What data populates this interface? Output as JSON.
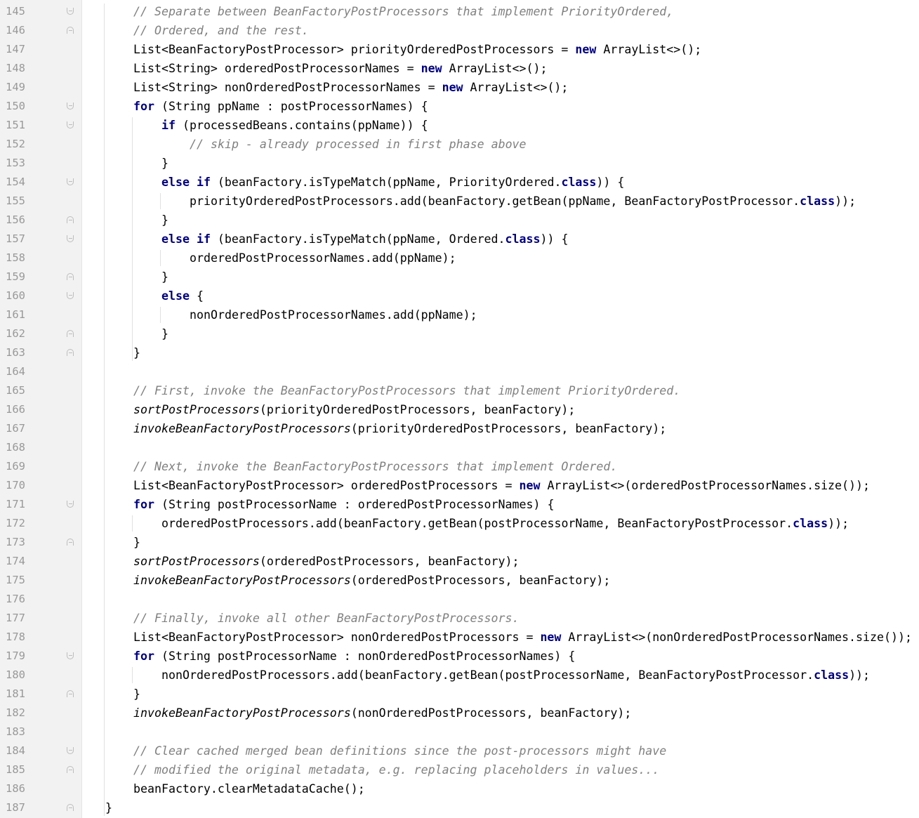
{
  "editor": {
    "colors": {
      "comment": "#808080",
      "keyword": "#000080",
      "line_number": "#999999",
      "gutter_bg": "#f2f2f2"
    },
    "lines": [
      {
        "num": "145",
        "fold": "open",
        "indent": 2,
        "code": [
          {
            "t": "// Separate between BeanFactoryPostProcessors that implement PriorityOrdered,",
            "c": "cmt"
          }
        ]
      },
      {
        "num": "146",
        "fold": "close",
        "indent": 2,
        "code": [
          {
            "t": "// Ordered, and the rest.",
            "c": "cmt"
          }
        ]
      },
      {
        "num": "147",
        "fold": "",
        "indent": 2,
        "code": [
          {
            "t": "List<BeanFactoryPostProcessor> priorityOrderedPostProcessors = ",
            "c": ""
          },
          {
            "t": "new",
            "c": "kw"
          },
          {
            "t": " ArrayList<>();",
            "c": ""
          }
        ]
      },
      {
        "num": "148",
        "fold": "",
        "indent": 2,
        "code": [
          {
            "t": "List<String> orderedPostProcessorNames = ",
            "c": ""
          },
          {
            "t": "new",
            "c": "kw"
          },
          {
            "t": " ArrayList<>();",
            "c": ""
          }
        ]
      },
      {
        "num": "149",
        "fold": "",
        "indent": 2,
        "code": [
          {
            "t": "List<String> nonOrderedPostProcessorNames = ",
            "c": ""
          },
          {
            "t": "new",
            "c": "kw"
          },
          {
            "t": " ArrayList<>();",
            "c": ""
          }
        ]
      },
      {
        "num": "150",
        "fold": "open",
        "indent": 2,
        "code": [
          {
            "t": "for",
            "c": "kw"
          },
          {
            "t": " (String ppName : postProcessorNames) {",
            "c": ""
          }
        ]
      },
      {
        "num": "151",
        "fold": "open",
        "indent": 3,
        "code": [
          {
            "t": "if",
            "c": "kw"
          },
          {
            "t": " (processedBeans.contains(ppName)) {",
            "c": ""
          }
        ]
      },
      {
        "num": "152",
        "fold": "",
        "indent": 4,
        "code": [
          {
            "t": "// skip - already processed in first phase above",
            "c": "cmt"
          }
        ]
      },
      {
        "num": "153",
        "fold": "",
        "indent": 3,
        "code": [
          {
            "t": "}",
            "c": ""
          }
        ]
      },
      {
        "num": "154",
        "fold": "open",
        "indent": 3,
        "code": [
          {
            "t": "else if",
            "c": "kw"
          },
          {
            "t": " (beanFactory.isTypeMatch(ppName, PriorityOrdered.",
            "c": ""
          },
          {
            "t": "class",
            "c": "kw"
          },
          {
            "t": ")) {",
            "c": ""
          }
        ]
      },
      {
        "num": "155",
        "fold": "",
        "indent": 4,
        "code": [
          {
            "t": "priorityOrderedPostProcessors.add(beanFactory.getBean(ppName, BeanFactoryPostProcessor.",
            "c": ""
          },
          {
            "t": "class",
            "c": "kw"
          },
          {
            "t": "));",
            "c": ""
          }
        ]
      },
      {
        "num": "156",
        "fold": "close",
        "indent": 3,
        "code": [
          {
            "t": "}",
            "c": ""
          }
        ]
      },
      {
        "num": "157",
        "fold": "open",
        "indent": 3,
        "code": [
          {
            "t": "else if",
            "c": "kw"
          },
          {
            "t": " (beanFactory.isTypeMatch(ppName, Ordered.",
            "c": ""
          },
          {
            "t": "class",
            "c": "kw"
          },
          {
            "t": ")) {",
            "c": ""
          }
        ]
      },
      {
        "num": "158",
        "fold": "",
        "indent": 4,
        "code": [
          {
            "t": "orderedPostProcessorNames.add(ppName);",
            "c": ""
          }
        ]
      },
      {
        "num": "159",
        "fold": "close",
        "indent": 3,
        "code": [
          {
            "t": "}",
            "c": ""
          }
        ]
      },
      {
        "num": "160",
        "fold": "open",
        "indent": 3,
        "code": [
          {
            "t": "else",
            "c": "kw"
          },
          {
            "t": " {",
            "c": ""
          }
        ]
      },
      {
        "num": "161",
        "fold": "",
        "indent": 4,
        "code": [
          {
            "t": "nonOrderedPostProcessorNames.add(ppName);",
            "c": ""
          }
        ]
      },
      {
        "num": "162",
        "fold": "close",
        "indent": 3,
        "code": [
          {
            "t": "}",
            "c": ""
          }
        ]
      },
      {
        "num": "163",
        "fold": "close",
        "indent": 2,
        "code": [
          {
            "t": "}",
            "c": ""
          }
        ]
      },
      {
        "num": "164",
        "fold": "",
        "indent": 2,
        "code": []
      },
      {
        "num": "165",
        "fold": "",
        "indent": 2,
        "code": [
          {
            "t": "// First, invoke the BeanFactoryPostProcessors that implement PriorityOrdered.",
            "c": "cmt"
          }
        ]
      },
      {
        "num": "166",
        "fold": "",
        "indent": 2,
        "code": [
          {
            "t": "sortPostProcessors",
            "c": "ital"
          },
          {
            "t": "(priorityOrderedPostProcessors, beanFactory);",
            "c": ""
          }
        ]
      },
      {
        "num": "167",
        "fold": "",
        "indent": 2,
        "code": [
          {
            "t": "invokeBeanFactoryPostProcessors",
            "c": "ital"
          },
          {
            "t": "(priorityOrderedPostProcessors, beanFactory);",
            "c": ""
          }
        ]
      },
      {
        "num": "168",
        "fold": "",
        "indent": 2,
        "code": []
      },
      {
        "num": "169",
        "fold": "",
        "indent": 2,
        "code": [
          {
            "t": "// Next, invoke the BeanFactoryPostProcessors that implement Ordered.",
            "c": "cmt"
          }
        ]
      },
      {
        "num": "170",
        "fold": "",
        "indent": 2,
        "code": [
          {
            "t": "List<BeanFactoryPostProcessor> orderedPostProcessors = ",
            "c": ""
          },
          {
            "t": "new",
            "c": "kw"
          },
          {
            "t": " ArrayList<>(orderedPostProcessorNames.size());",
            "c": ""
          }
        ]
      },
      {
        "num": "171",
        "fold": "open",
        "indent": 2,
        "code": [
          {
            "t": "for",
            "c": "kw"
          },
          {
            "t": " (String postProcessorName : orderedPostProcessorNames) {",
            "c": ""
          }
        ]
      },
      {
        "num": "172",
        "fold": "",
        "indent": 3,
        "code": [
          {
            "t": "orderedPostProcessors.add(beanFactory.getBean(postProcessorName, BeanFactoryPostProcessor.",
            "c": ""
          },
          {
            "t": "class",
            "c": "kw"
          },
          {
            "t": "));",
            "c": ""
          }
        ]
      },
      {
        "num": "173",
        "fold": "close",
        "indent": 2,
        "code": [
          {
            "t": "}",
            "c": ""
          }
        ]
      },
      {
        "num": "174",
        "fold": "",
        "indent": 2,
        "code": [
          {
            "t": "sortPostProcessors",
            "c": "ital"
          },
          {
            "t": "(orderedPostProcessors, beanFactory);",
            "c": ""
          }
        ]
      },
      {
        "num": "175",
        "fold": "",
        "indent": 2,
        "code": [
          {
            "t": "invokeBeanFactoryPostProcessors",
            "c": "ital"
          },
          {
            "t": "(orderedPostProcessors, beanFactory);",
            "c": ""
          }
        ]
      },
      {
        "num": "176",
        "fold": "",
        "indent": 2,
        "code": []
      },
      {
        "num": "177",
        "fold": "",
        "indent": 2,
        "code": [
          {
            "t": "// Finally, invoke all other BeanFactoryPostProcessors.",
            "c": "cmt"
          }
        ]
      },
      {
        "num": "178",
        "fold": "",
        "indent": 2,
        "code": [
          {
            "t": "List<BeanFactoryPostProcessor> nonOrderedPostProcessors = ",
            "c": ""
          },
          {
            "t": "new",
            "c": "kw"
          },
          {
            "t": " ArrayList<>(nonOrderedPostProcessorNames.size());",
            "c": ""
          }
        ]
      },
      {
        "num": "179",
        "fold": "open",
        "indent": 2,
        "code": [
          {
            "t": "for",
            "c": "kw"
          },
          {
            "t": " (String postProcessorName : nonOrderedPostProcessorNames) {",
            "c": ""
          }
        ]
      },
      {
        "num": "180",
        "fold": "",
        "indent": 3,
        "code": [
          {
            "t": "nonOrderedPostProcessors.add(beanFactory.getBean(postProcessorName, BeanFactoryPostProcessor.",
            "c": ""
          },
          {
            "t": "class",
            "c": "kw"
          },
          {
            "t": "));",
            "c": ""
          }
        ]
      },
      {
        "num": "181",
        "fold": "close",
        "indent": 2,
        "code": [
          {
            "t": "}",
            "c": ""
          }
        ]
      },
      {
        "num": "182",
        "fold": "",
        "indent": 2,
        "code": [
          {
            "t": "invokeBeanFactoryPostProcessors",
            "c": "ital"
          },
          {
            "t": "(nonOrderedPostProcessors, beanFactory);",
            "c": ""
          }
        ]
      },
      {
        "num": "183",
        "fold": "",
        "indent": 2,
        "code": []
      },
      {
        "num": "184",
        "fold": "open",
        "indent": 2,
        "code": [
          {
            "t": "// Clear cached merged bean definitions since the post-processors might have",
            "c": "cmt"
          }
        ]
      },
      {
        "num": "185",
        "fold": "close",
        "indent": 2,
        "code": [
          {
            "t": "// modified the original metadata, e.g. replacing placeholders in values...",
            "c": "cmt"
          }
        ]
      },
      {
        "num": "186",
        "fold": "",
        "indent": 2,
        "code": [
          {
            "t": "beanFactory.clearMetadataCache();",
            "c": ""
          }
        ]
      },
      {
        "num": "187",
        "fold": "close",
        "indent": 1,
        "code": [
          {
            "t": "}",
            "c": ""
          }
        ]
      }
    ]
  }
}
